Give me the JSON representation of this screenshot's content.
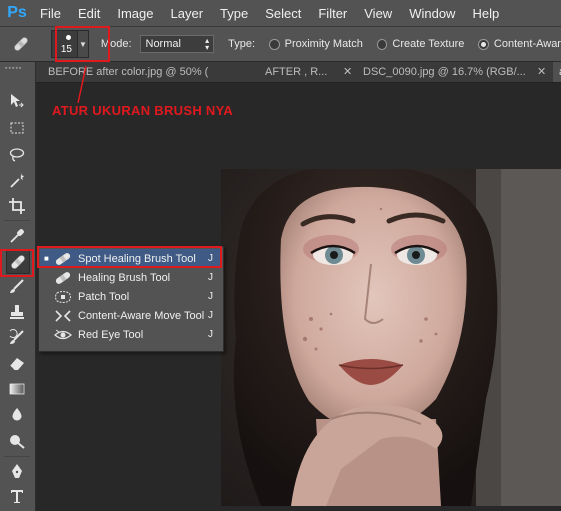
{
  "menubar": {
    "logo": "Ps",
    "items": [
      "File",
      "Edit",
      "Image",
      "Layer",
      "Type",
      "Select",
      "Filter",
      "View",
      "Window",
      "Help"
    ]
  },
  "options": {
    "brush_size": "15",
    "mode_label": "Mode:",
    "mode_value": "Normal",
    "type_label": "Type:",
    "radios": [
      {
        "label": "Proximity Match",
        "selected": false
      },
      {
        "label": "Create Texture",
        "selected": false
      },
      {
        "label": "Content-Awar",
        "selected": true
      }
    ]
  },
  "tabs": [
    {
      "title": "BEFORE after color.jpg @ 50% ("
    },
    {
      "title": "AFTER  , R..."
    },
    {
      "title": "DSC_0090.jpg @ 16.7% (RGB/..."
    },
    {
      "title": "a"
    }
  ],
  "annotation": "ATUR UKURAN BRUSH NYA",
  "flyout": {
    "items": [
      {
        "label": "Spot Healing Brush Tool",
        "shortcut": "J",
        "selected": true,
        "icon": "spot-healing-brush-icon"
      },
      {
        "label": "Healing Brush Tool",
        "shortcut": "J",
        "selected": false,
        "icon": "healing-brush-icon"
      },
      {
        "label": "Patch Tool",
        "shortcut": "J",
        "selected": false,
        "icon": "patch-icon"
      },
      {
        "label": "Content-Aware Move Tool",
        "shortcut": "J",
        "selected": false,
        "icon": "content-aware-move-icon"
      },
      {
        "label": "Red Eye Tool",
        "shortcut": "J",
        "selected": false,
        "icon": "red-eye-icon"
      }
    ]
  },
  "colors": {
    "highlight_red": "#e0191f",
    "selection_blue": "#3f5a84",
    "panel_gray": "#535353",
    "ps_blue": "#31a8ff"
  }
}
